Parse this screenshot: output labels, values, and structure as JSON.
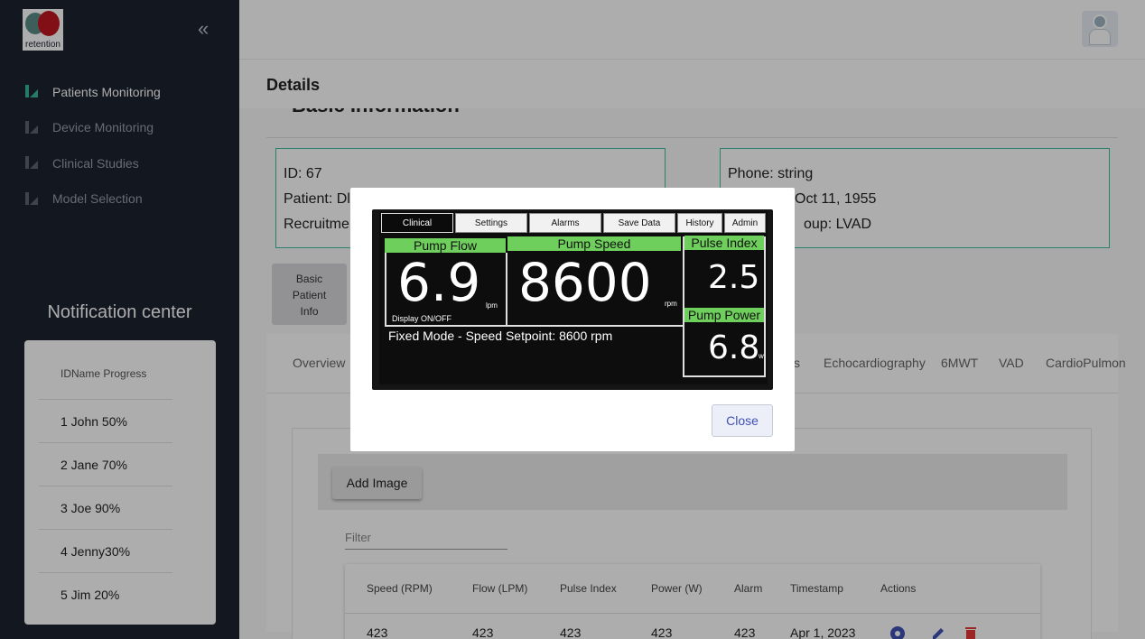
{
  "sidebar": {
    "logo_text": "retention",
    "collapse_icon": "«",
    "items": [
      {
        "label": "Patients Monitoring",
        "active": true
      },
      {
        "label": "Device Monitoring",
        "active": false
      },
      {
        "label": "Clinical Studies",
        "active": false
      },
      {
        "label": "Model Selection",
        "active": false
      }
    ],
    "notification": {
      "title": "Notification center",
      "header": "IDName Progress",
      "rows": [
        "1 John   50%",
        "2 Jane   70%",
        "3 Joe    90%",
        "4 Jenny30%",
        "5 Jim    20%"
      ]
    }
  },
  "header": {
    "page_title": "Details"
  },
  "basic_info": {
    "section_title": "Basic Information",
    "left": [
      "ID: 67",
      "Patient: Dl",
      "Recruitme"
    ],
    "right": [
      "Phone: string",
      "Oct 11, 1955",
      "oup: LVAD"
    ]
  },
  "tiles": {
    "basic_patient_info": "Basic\nPatient\nInfo"
  },
  "tabs": [
    {
      "label": "Overview"
    },
    {
      "label": "s"
    },
    {
      "label": "Echocardiography"
    },
    {
      "label": "6MWT"
    },
    {
      "label": "VAD"
    },
    {
      "label": "CardioPulmon"
    }
  ],
  "images_panel": {
    "add_button": "Add Image",
    "filter_placeholder": "Filter"
  },
  "table": {
    "columns": [
      "Speed (RPM)",
      "Flow (LPM)",
      "Pulse Index",
      "Power (W)",
      "Alarm",
      "Timestamp",
      "Actions"
    ],
    "rows": [
      [
        "423",
        "423",
        "423",
        "423",
        "423",
        "Apr 1, 2023"
      ]
    ]
  },
  "modal": {
    "close_label": "Close",
    "photo": {
      "tabs": [
        "Clinical",
        "Settings",
        "Alarms",
        "Save Data",
        "History",
        "Admin"
      ],
      "pump_flow_label": "Pump Flow",
      "pump_flow_value": "6.9",
      "pump_flow_unit": "lpm",
      "pump_speed_label": "Pump Speed",
      "pump_speed_value": "8600",
      "pump_speed_unit": "rpm",
      "pulse_index_label": "Pulse Index",
      "pulse_index_value": "2.5",
      "pump_power_label": "Pump Power",
      "pump_power_value": "6.8",
      "pump_power_unit": "w",
      "display_toggle": "Display ON/OFF",
      "fixed_mode_text": "Fixed Mode - Speed Setpoint:  8600  rpm"
    }
  },
  "colors": {
    "sidebar_bg": "#1d2230",
    "accent": "#35b59b",
    "brand_red": "#c0171f",
    "close_text": "#3f51b5",
    "screen_green": "#6fcf5c"
  }
}
